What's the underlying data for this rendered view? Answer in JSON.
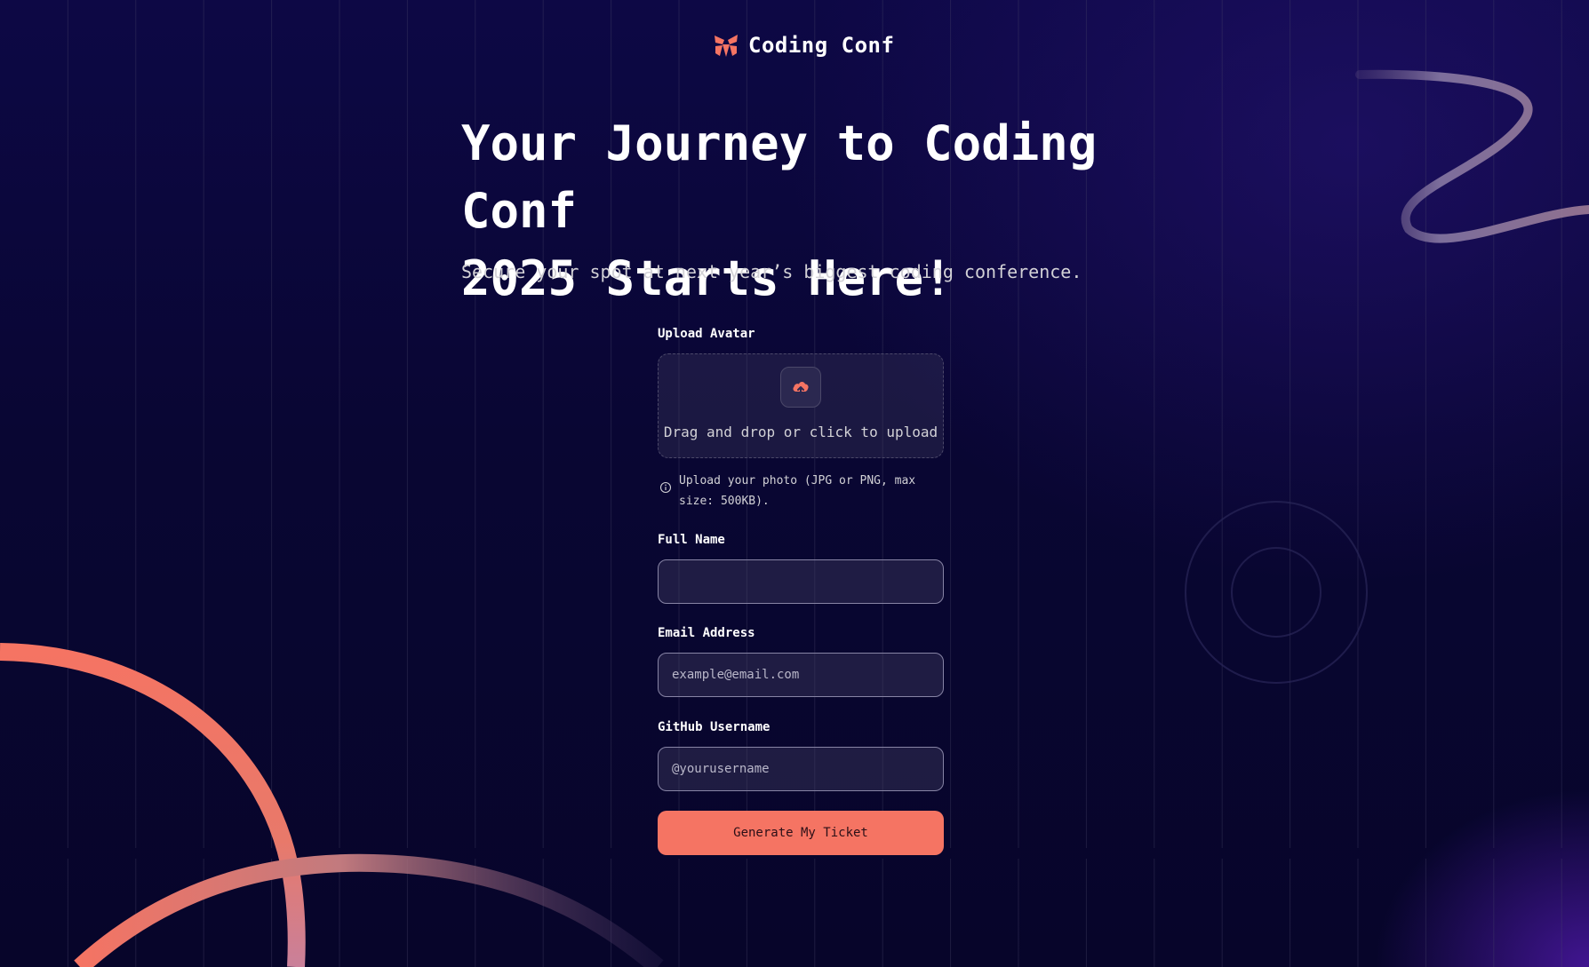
{
  "brand": {
    "name": "Coding Conf",
    "logo_icon": "coding-conf-logo-icon",
    "accent_color": "#f57463"
  },
  "hero": {
    "title_line1": "Your Journey to Coding Conf",
    "title_line2": "2025 Starts Here!",
    "subtitle": "Secure your spot at next year’s biggest coding conference."
  },
  "form": {
    "avatar": {
      "label": "Upload Avatar",
      "dropzone_text": "Drag and drop or click to upload",
      "icon": "cloud-upload-icon",
      "hint_icon": "info-icon",
      "hint_line1": "Upload your photo (JPG or PNG, max",
      "hint_line2": "size: 500KB)."
    },
    "full_name": {
      "label": "Full Name",
      "value": "",
      "placeholder": ""
    },
    "email": {
      "label": "Email Address",
      "value": "",
      "placeholder": "example@email.com"
    },
    "github": {
      "label": "GitHub Username",
      "value": "",
      "placeholder": "@yourusername"
    },
    "submit_label": "Generate My Ticket"
  }
}
